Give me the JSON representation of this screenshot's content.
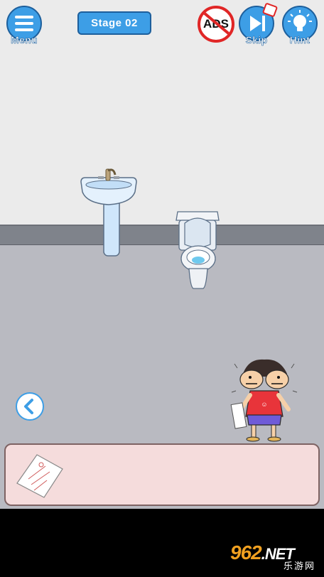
{
  "hud": {
    "menu_label": "Menu",
    "stage_label": "Stage 02",
    "ads_label": "ADS",
    "skip_label": "Skip",
    "hint_label": "Hint"
  },
  "watermark": {
    "main": "962",
    "suffix": ".NET",
    "sub": "乐游网"
  },
  "colors": {
    "button_blue": "#3d9ee6",
    "button_border": "#1d5f9c",
    "ads_red": "#e02626",
    "wall": "#ebebeb",
    "floor": "#b9bac1",
    "inventory_bg": "#f5dcdc",
    "shirt_red": "#e8343a",
    "shorts_purple": "#6f5bd8"
  },
  "icons": {
    "menu": "hamburger-icon",
    "skip": "skip-forward-icon",
    "hint": "lightbulb-icon",
    "back": "chevron-left-icon"
  },
  "inventory": {
    "items": [
      "torn-paper"
    ]
  }
}
